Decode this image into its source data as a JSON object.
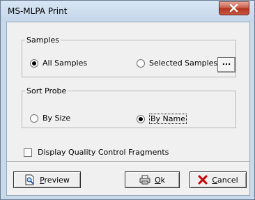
{
  "window": {
    "title": "MS-MLPA Print"
  },
  "samples": {
    "legend": "Samples",
    "all_label": "All Samples",
    "selected_label": "Selected Samples",
    "browse_label": "...",
    "selected_option": "All Samples"
  },
  "sort_probe": {
    "legend": "Sort Probe",
    "size_label": "By Size",
    "name_label": "By Name",
    "selected_option": "By Name"
  },
  "display_qc": {
    "label": "Display Quality Control Fragments",
    "checked": false
  },
  "buttons": {
    "preview": {
      "mnemonic": "P",
      "rest": "review",
      "icon": "preview-icon"
    },
    "ok": {
      "mnemonic": "O",
      "rest": "k",
      "icon": "printer-icon"
    },
    "cancel": {
      "mnemonic": "C",
      "rest": "ancel",
      "icon": "red-x-icon"
    }
  },
  "colors": {
    "close_button": "#c75f4b",
    "cancel_icon": "#cc0000"
  }
}
